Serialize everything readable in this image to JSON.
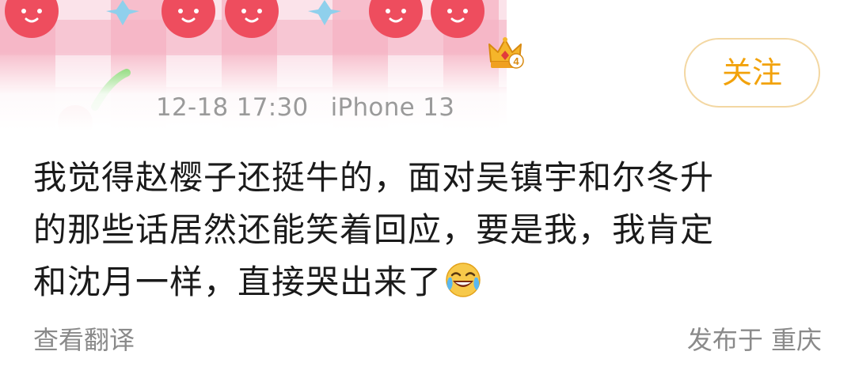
{
  "post": {
    "meta": {
      "time": "12-18 17:30",
      "device": "iPhone 13"
    },
    "follow_label": "关注",
    "body_lines": [
      "我觉得赵樱子还挺牛的，面对吴镇宇和尔冬升",
      "的那些话居然还能笑着回应，要是我，我肯定",
      "和沈月一样，直接哭出来了"
    ],
    "emoji": "laugh-cry-icon",
    "translate_label": "查看翻译",
    "location_label": "发布于 重庆",
    "badge_icon": "crown-icon",
    "badge_level": "4"
  },
  "colors": {
    "accent": "#f2a20b",
    "follow_border": "#f3d7a2",
    "meta_text": "#9a9a9a",
    "body_text": "#1a1a1a",
    "banner_pink": "#f27a9a",
    "banner_cherry": "#ee4d5e"
  }
}
